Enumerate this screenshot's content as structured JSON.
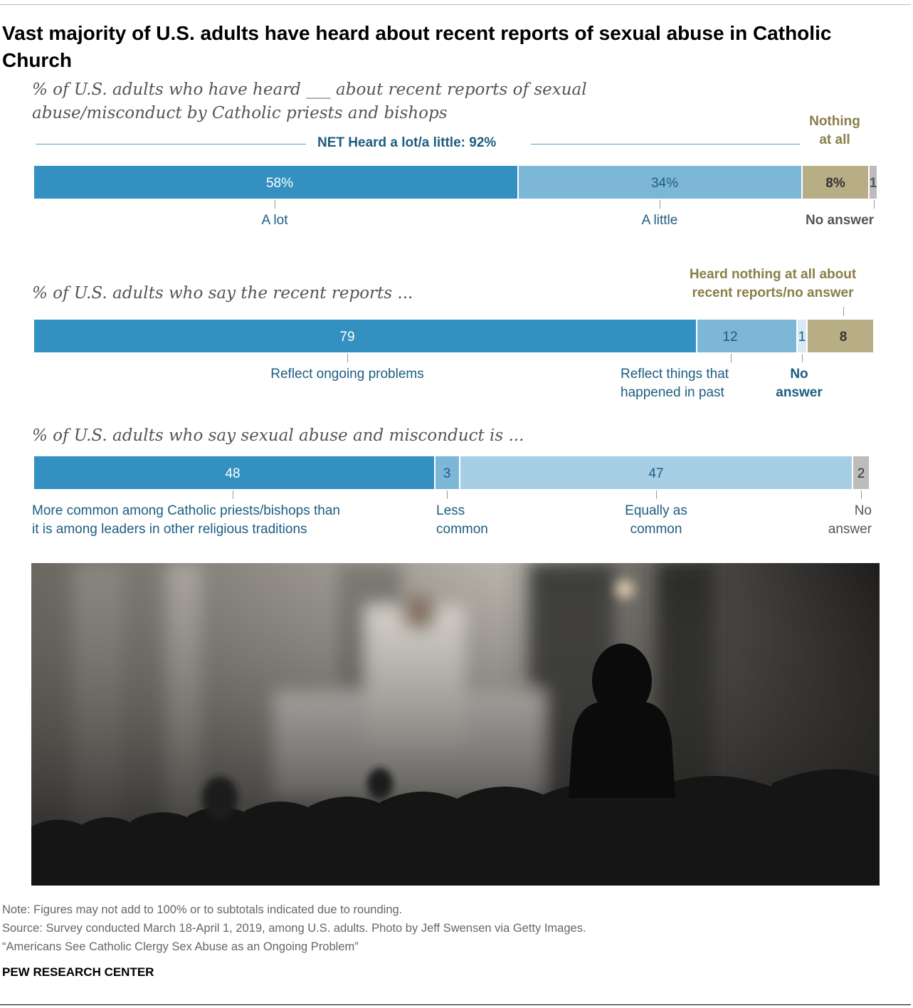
{
  "title": "Vast majority of U.S. adults have heard about recent reports of sexual abuse in Catholic Church",
  "colors": {
    "dark_blue": "#3390c1",
    "light_blue": "#7db7d8",
    "pale_blue": "#a6cfe6",
    "tan": "#b8ae85",
    "grey": "#bcbcbc",
    "label_blue": "#1c5d82",
    "label_olive": "#8a7e48"
  },
  "chart_data": [
    {
      "type": "bar",
      "orientation": "horizontal-stacked",
      "subtitle": "% of U.S. adults who have heard ___ about recent reports of sexual abuse/misconduct by Catholic priests and bishops",
      "net_label": "NET Heard a lot/a little: 92%",
      "series": [
        {
          "name": "A lot",
          "value": 58,
          "label": "58%"
        },
        {
          "name": "A little",
          "value": 34,
          "label": "34%"
        },
        {
          "name": "Nothing at all",
          "value": 8,
          "label": "8%"
        },
        {
          "name": "No answer",
          "value": 1,
          "label": "1"
        }
      ],
      "category_labels": {
        "a_lot": "A lot",
        "a_little": "A little",
        "nothing_line1": "Nothing",
        "nothing_line2": "at all",
        "no_answer": "No answer"
      }
    },
    {
      "type": "bar",
      "orientation": "horizontal-stacked",
      "subtitle": "% of U.S. adults who say the recent reports ...",
      "series": [
        {
          "name": "Reflect ongoing problems",
          "value": 79,
          "label": "79"
        },
        {
          "name": "Reflect things that happened in past",
          "value": 12,
          "label": "12"
        },
        {
          "name": "No answer",
          "value": 1,
          "label": "1"
        },
        {
          "name": "Heard nothing at all about recent reports/no answer",
          "value": 8,
          "label": "8"
        }
      ],
      "category_labels": {
        "ongoing": "Reflect ongoing problems",
        "past_line1": "Reflect things that",
        "past_line2": "happened in past",
        "no_answer_line1": "No",
        "no_answer_line2": "answer",
        "heard_nothing_line1": "Heard nothing at all about",
        "heard_nothing_line2": "recent reports/no answer"
      }
    },
    {
      "type": "bar",
      "orientation": "horizontal-stacked",
      "subtitle": "% of U.S. adults who say sexual abuse and misconduct is ...",
      "series": [
        {
          "name": "More common among Catholic priests/bishops than it is among leaders in other religious traditions",
          "value": 48,
          "label": "48"
        },
        {
          "name": "Less common",
          "value": 3,
          "label": "3"
        },
        {
          "name": "Equally as common",
          "value": 47,
          "label": "47"
        },
        {
          "name": "No answer",
          "value": 2,
          "label": "2"
        }
      ],
      "category_labels": {
        "more_line1": "More common among Catholic priests/bishops than",
        "more_line2": "it is among leaders in other religious traditions",
        "less_line1": "Less",
        "less_line2": "common",
        "equal_line1": "Equally as",
        "equal_line2": "common",
        "no_answer_line1": "No",
        "no_answer_line2": "answer"
      }
    }
  ],
  "footer": {
    "note": "Note: Figures may not add to 100% or to subtotals indicated due to rounding.",
    "source": "Source: Survey conducted March 18-April 1, 2019, among U.S. adults. Photo by Jeff Swensen via Getty Images.",
    "report": "“Americans See Catholic Clergy Sex Abuse as an Ongoing Problem”",
    "brand": "PEW RESEARCH CENTER"
  }
}
